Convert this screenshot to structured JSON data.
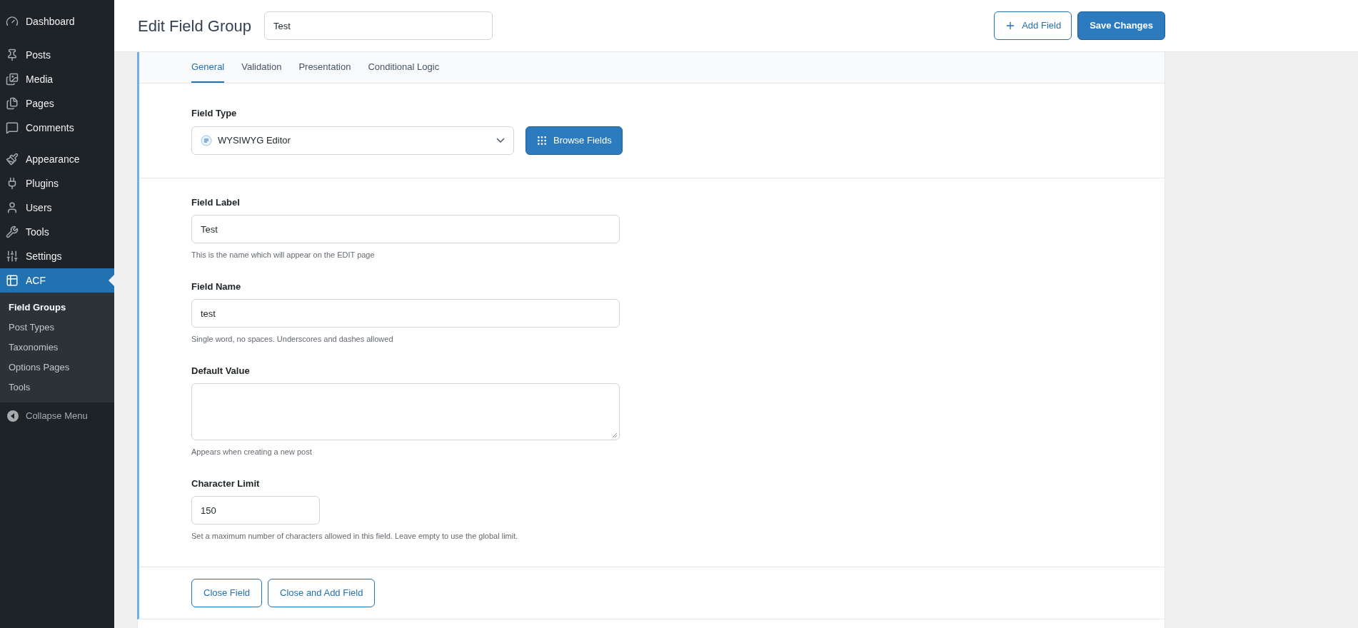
{
  "sidebar": {
    "groups": [
      [
        {
          "label": "Dashboard",
          "selected": false
        }
      ],
      [
        {
          "label": "Posts",
          "selected": false
        },
        {
          "label": "Media",
          "selected": false
        },
        {
          "label": "Pages",
          "selected": false
        },
        {
          "label": "Comments",
          "selected": false
        }
      ],
      [
        {
          "label": "Appearance",
          "selected": false
        },
        {
          "label": "Plugins",
          "selected": false
        },
        {
          "label": "Users",
          "selected": false
        },
        {
          "label": "Tools",
          "selected": false
        },
        {
          "label": "Settings",
          "selected": false
        },
        {
          "label": "ACF",
          "selected": true
        }
      ]
    ],
    "submenu": [
      {
        "label": "Field Groups",
        "selected": true
      },
      {
        "label": "Post Types",
        "selected": false
      },
      {
        "label": "Taxonomies",
        "selected": false
      },
      {
        "label": "Options Pages",
        "selected": false
      },
      {
        "label": "Tools",
        "selected": false
      }
    ],
    "collapse": "Collapse Menu"
  },
  "header": {
    "title": "Edit Field Group",
    "title_value": "Test",
    "add_button": "Add Field",
    "save_button": "Save Changes"
  },
  "tabs": [
    {
      "label": "General",
      "selected": true
    },
    {
      "label": "Validation",
      "selected": false
    },
    {
      "label": "Presentation",
      "selected": false
    },
    {
      "label": "Conditional Logic",
      "selected": false
    }
  ],
  "field_type": {
    "label": "Field Type",
    "value": "WYSIWYG Editor",
    "browse_button": "Browse Fields"
  },
  "fields": [
    {
      "kind": "text",
      "label": "Field Label",
      "value": "Test",
      "hint": "This is the name which will appear on the EDIT page"
    },
    {
      "kind": "text",
      "label": "Field Name",
      "value": "test",
      "hint": "Single word, no spaces. Underscores and dashes allowed"
    },
    {
      "kind": "textarea",
      "label": "Default Value",
      "hint": "Appears when creating a new post"
    },
    {
      "kind": "number",
      "label": "Character Limit",
      "value": "150",
      "hint": "Set a maximum number of characters allowed in this field. Leave empty to use the global limit."
    }
  ],
  "footer_buttons": [
    "Close Field",
    "Close and Add Field"
  ]
}
